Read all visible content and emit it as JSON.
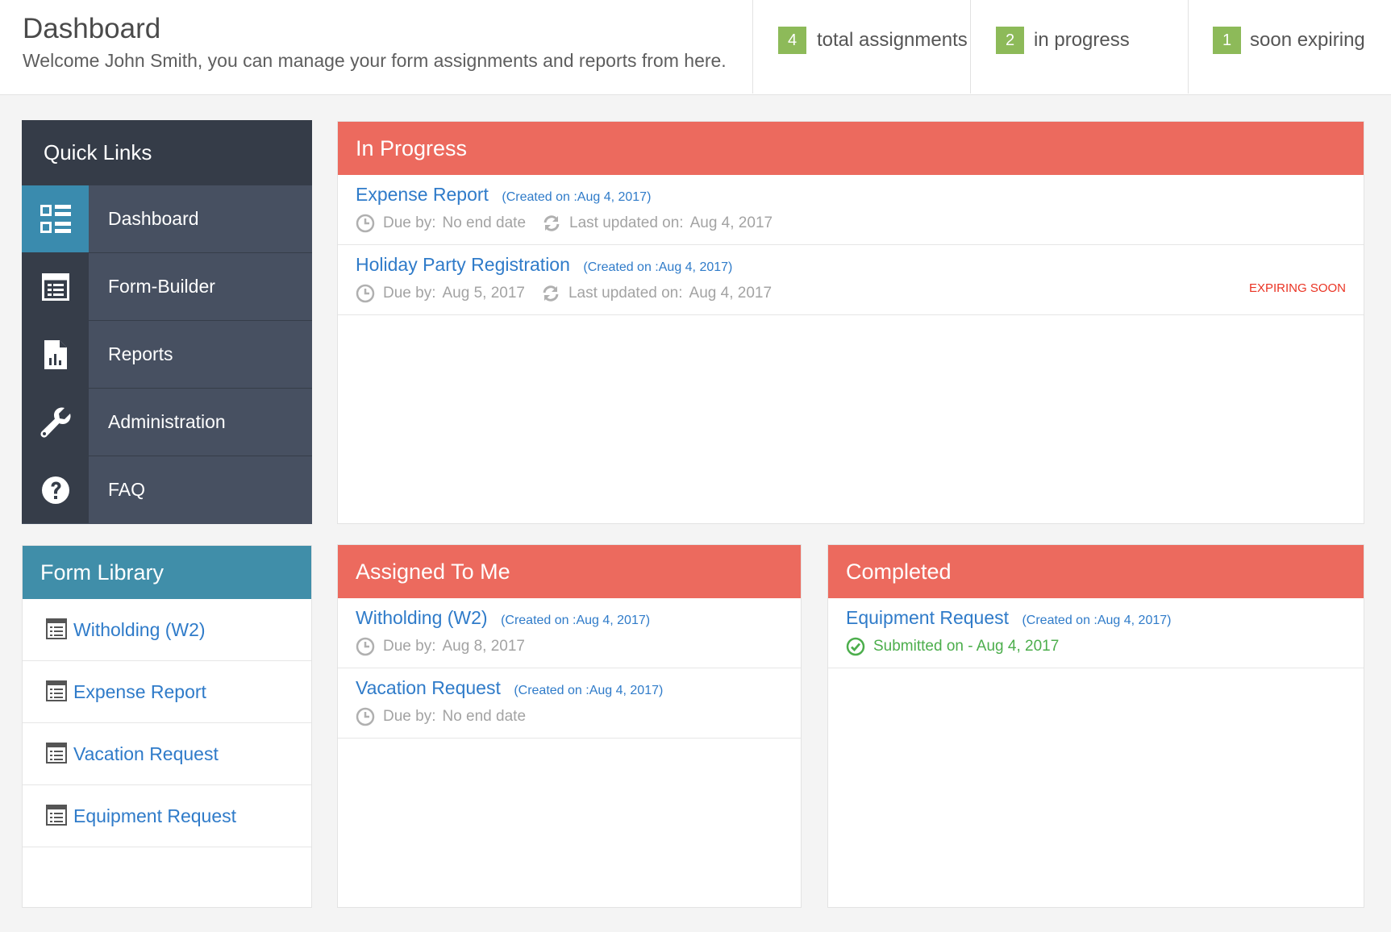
{
  "header": {
    "title": "Dashboard",
    "welcome": "Welcome John Smith, you can manage your form assignments and reports from here."
  },
  "stats": [
    {
      "count": "4",
      "label": "total assignments"
    },
    {
      "count": "2",
      "label": "in progress"
    },
    {
      "count": "1",
      "label": "soon expiring"
    }
  ],
  "quick_links": {
    "title": "Quick Links",
    "items": [
      {
        "label": "Dashboard",
        "icon": "dashboard-icon",
        "active": true
      },
      {
        "label": "Form-Builder",
        "icon": "form-builder-icon"
      },
      {
        "label": "Reports",
        "icon": "report-file-icon"
      },
      {
        "label": "Administration",
        "icon": "wrench-icon"
      },
      {
        "label": "FAQ",
        "icon": "question-icon"
      }
    ]
  },
  "in_progress": {
    "title": "In Progress",
    "items": [
      {
        "title": "Expense Report",
        "created": "(Created on :Aug 4, 2017)",
        "due_label": "Due by:",
        "due": "No end date",
        "updated_label": "Last updated on:",
        "updated": "Aug 4, 2017",
        "flag": ""
      },
      {
        "title": "Holiday Party Registration",
        "created": "(Created on :Aug 4, 2017)",
        "due_label": "Due by:",
        "due": "Aug 5, 2017",
        "updated_label": "Last updated on:",
        "updated": "Aug 4, 2017",
        "flag": "EXPIRING SOON"
      }
    ]
  },
  "form_library": {
    "title": "Form Library",
    "items": [
      "Witholding (W2)",
      "Expense Report",
      "Vacation Request",
      "Equipment Request"
    ]
  },
  "assigned": {
    "title": "Assigned To Me",
    "items": [
      {
        "title": "Witholding (W2)",
        "created": "(Created on :Aug 4, 2017)",
        "due_label": "Due by:",
        "due": "Aug 8, 2017"
      },
      {
        "title": "Vacation Request",
        "created": "(Created on :Aug 4, 2017)",
        "due_label": "Due by:",
        "due": "No end date"
      }
    ]
  },
  "completed": {
    "title": "Completed",
    "items": [
      {
        "title": "Equipment Request",
        "created": "(Created on :Aug 4, 2017)",
        "submitted": "Submitted on - Aug 4, 2017"
      }
    ]
  },
  "colors": {
    "accent_red": "#ec6a5e",
    "accent_teal": "#408ea9",
    "badge_green": "#8dba59",
    "link_blue": "#2f7bc9",
    "warning_red": "#ea3323",
    "success_green": "#4cae4c"
  }
}
